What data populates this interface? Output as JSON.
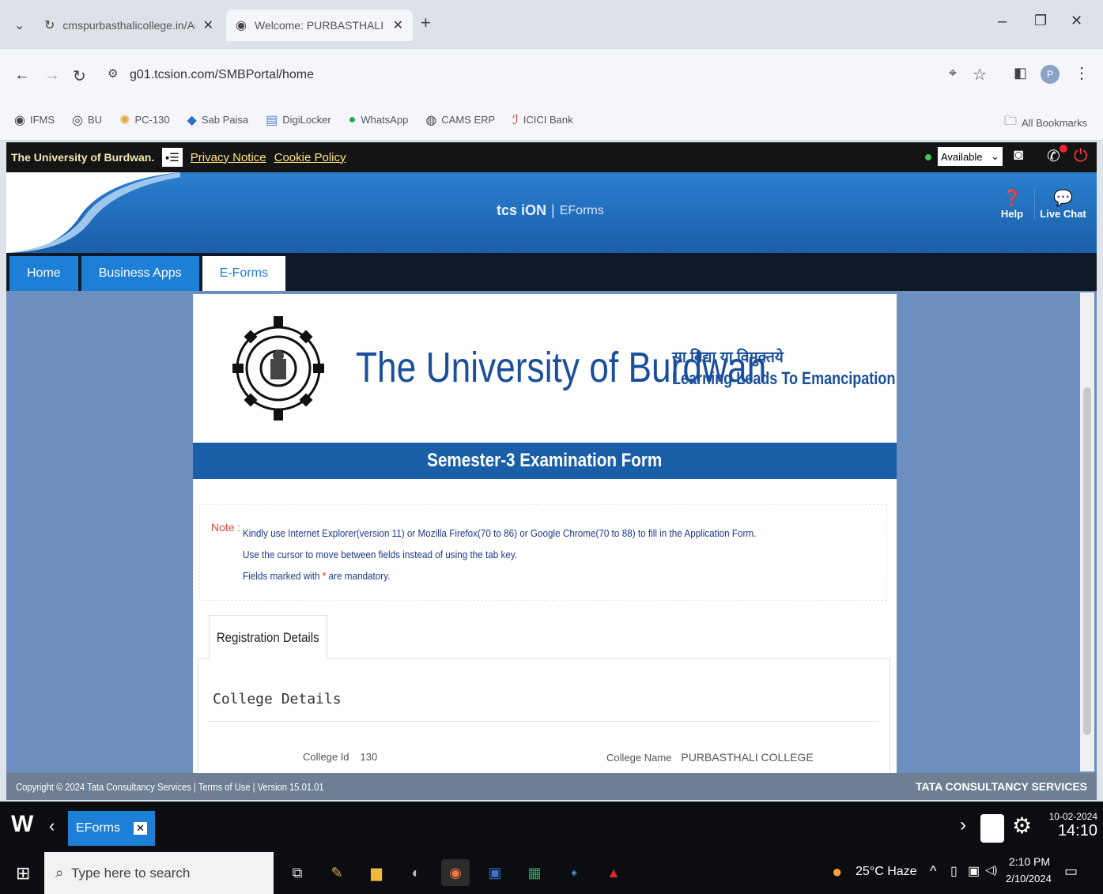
{
  "browser": {
    "tabs": [
      {
        "title": "cmspurbasthalicollege.in/Adm"
      },
      {
        "title": "Welcome: PURBASTHALI COL."
      }
    ],
    "new_tab": "+",
    "url": "g01.tcsion.com/SMBPortal/home",
    "bookmarks": [
      "IFMS",
      "BU",
      "PC-130",
      "Sab Paisa",
      "DigiLocker",
      "WhatsApp",
      "CAMS ERP",
      "ICICI Bank"
    ],
    "all_bookmarks": "All Bookmarks",
    "profile_initial": "P"
  },
  "portal": {
    "university_label": "The University of Burdwan.",
    "privacy": "Privacy Notice",
    "cookie": "Cookie Policy",
    "status": "Available",
    "brand": "tcs iON",
    "module": "EForms",
    "help": "Help",
    "live_chat": "Live Chat",
    "nav": [
      "Home",
      "Business Apps",
      "E-Forms"
    ]
  },
  "form": {
    "university_name": "The University of Burdwan",
    "motto_hindi": "सा विद्या या विमुक्तये",
    "motto_english": "Learning Leads To Emancipation",
    "title": "Semester-3 Examination Form",
    "note_label": "Note :",
    "note_lines": [
      "Kindly use Internet Explorer(version 11) or Mozilla Firefox(70 to 86) or Google Chrome(70 to 88) to fill in the Application Form.",
      "Use the cursor to move between fields instead of using the tab key.",
      "Fields marked with"
    ],
    "mandatory_star": "*",
    "mandatory_suffix": "are mandatory.",
    "tab": "Registration Details",
    "section": "College Details",
    "college_id_label": "College Id",
    "college_id": "130",
    "college_name_label": "College Name",
    "college_name": "PURBASTHALI COLLEGE"
  },
  "footer": {
    "copyright": "Copyright © 2024 Tata Consultancy Services | Terms of Use | Version 15.01.01",
    "tcs": "TATA CONSULTANCY SERVICES"
  },
  "taskbar": {
    "app_tab": "EForms",
    "date1": "10-02-2024",
    "time1": "14:10",
    "search": "Type here to search",
    "weather": "25°C  Haze",
    "time2": "2:10 PM",
    "date2": "2/10/2024"
  },
  "colors": {
    "accent": "#1e7fd6",
    "brand_blue": "#1a4f9c",
    "note_red": "#d64a3a"
  }
}
